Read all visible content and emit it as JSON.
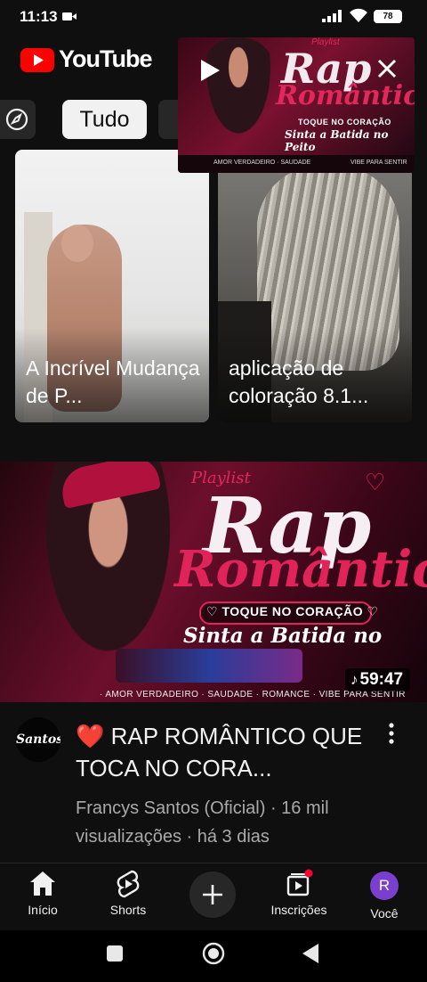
{
  "status_bar": {
    "time": "11:13",
    "battery": "78"
  },
  "header": {
    "app_name": "YouTube"
  },
  "chips": {
    "selected": "Tudo"
  },
  "miniplayer": {
    "thumb_text": {
      "badge": "Playlist",
      "line1": "Rap",
      "line2": "Romântico",
      "tagline": "TOQUE NO CORAÇÃO",
      "subline": "Sinta a Batida no Peito",
      "footer": "AMOR VERDADEIRO · SAUDADE",
      "footer2": "VIBE PARA SENTIR"
    }
  },
  "shorts": [
    {
      "title": "A Incrível Mudança de P..."
    },
    {
      "title": "aplicação de coloração 8.1..."
    }
  ],
  "video": {
    "thumb_text": {
      "badge": "Playlist",
      "line1": "Rap",
      "line2": "Romântico",
      "tagline": "♡ TOQUE NO CORAÇÃO ♡",
      "subline": "Sinta a Batida no Peito!",
      "tags": "· AMOR VERDADEIRO · SAUDADE · ROMANCE · VIBE PARA SENTIR"
    },
    "duration": "59:47",
    "channel_avatar_text": "Santos",
    "title": "❤️ RAP ROMÂNTICO QUE TOCA NO CORA...",
    "channel": "Francys Santos (Oficial)",
    "views": "16 mil visualizações",
    "age": "há 3 dias",
    "meta_separator": " · "
  },
  "bottom_nav": {
    "items": [
      {
        "label": "Início",
        "icon": "home-icon",
        "active": true
      },
      {
        "label": "Shorts",
        "icon": "shorts-icon"
      },
      {
        "label": "",
        "icon": "add-icon"
      },
      {
        "label": "Inscrições",
        "icon": "subscriptions-icon",
        "badge": true
      },
      {
        "label": "Você",
        "icon": "avatar",
        "avatar_letter": "R"
      }
    ]
  },
  "colors": {
    "brand": "#ff0000",
    "background": "#0f0f0f",
    "accent_pink": "#e0245a",
    "avatar": "#7b3fd0"
  }
}
